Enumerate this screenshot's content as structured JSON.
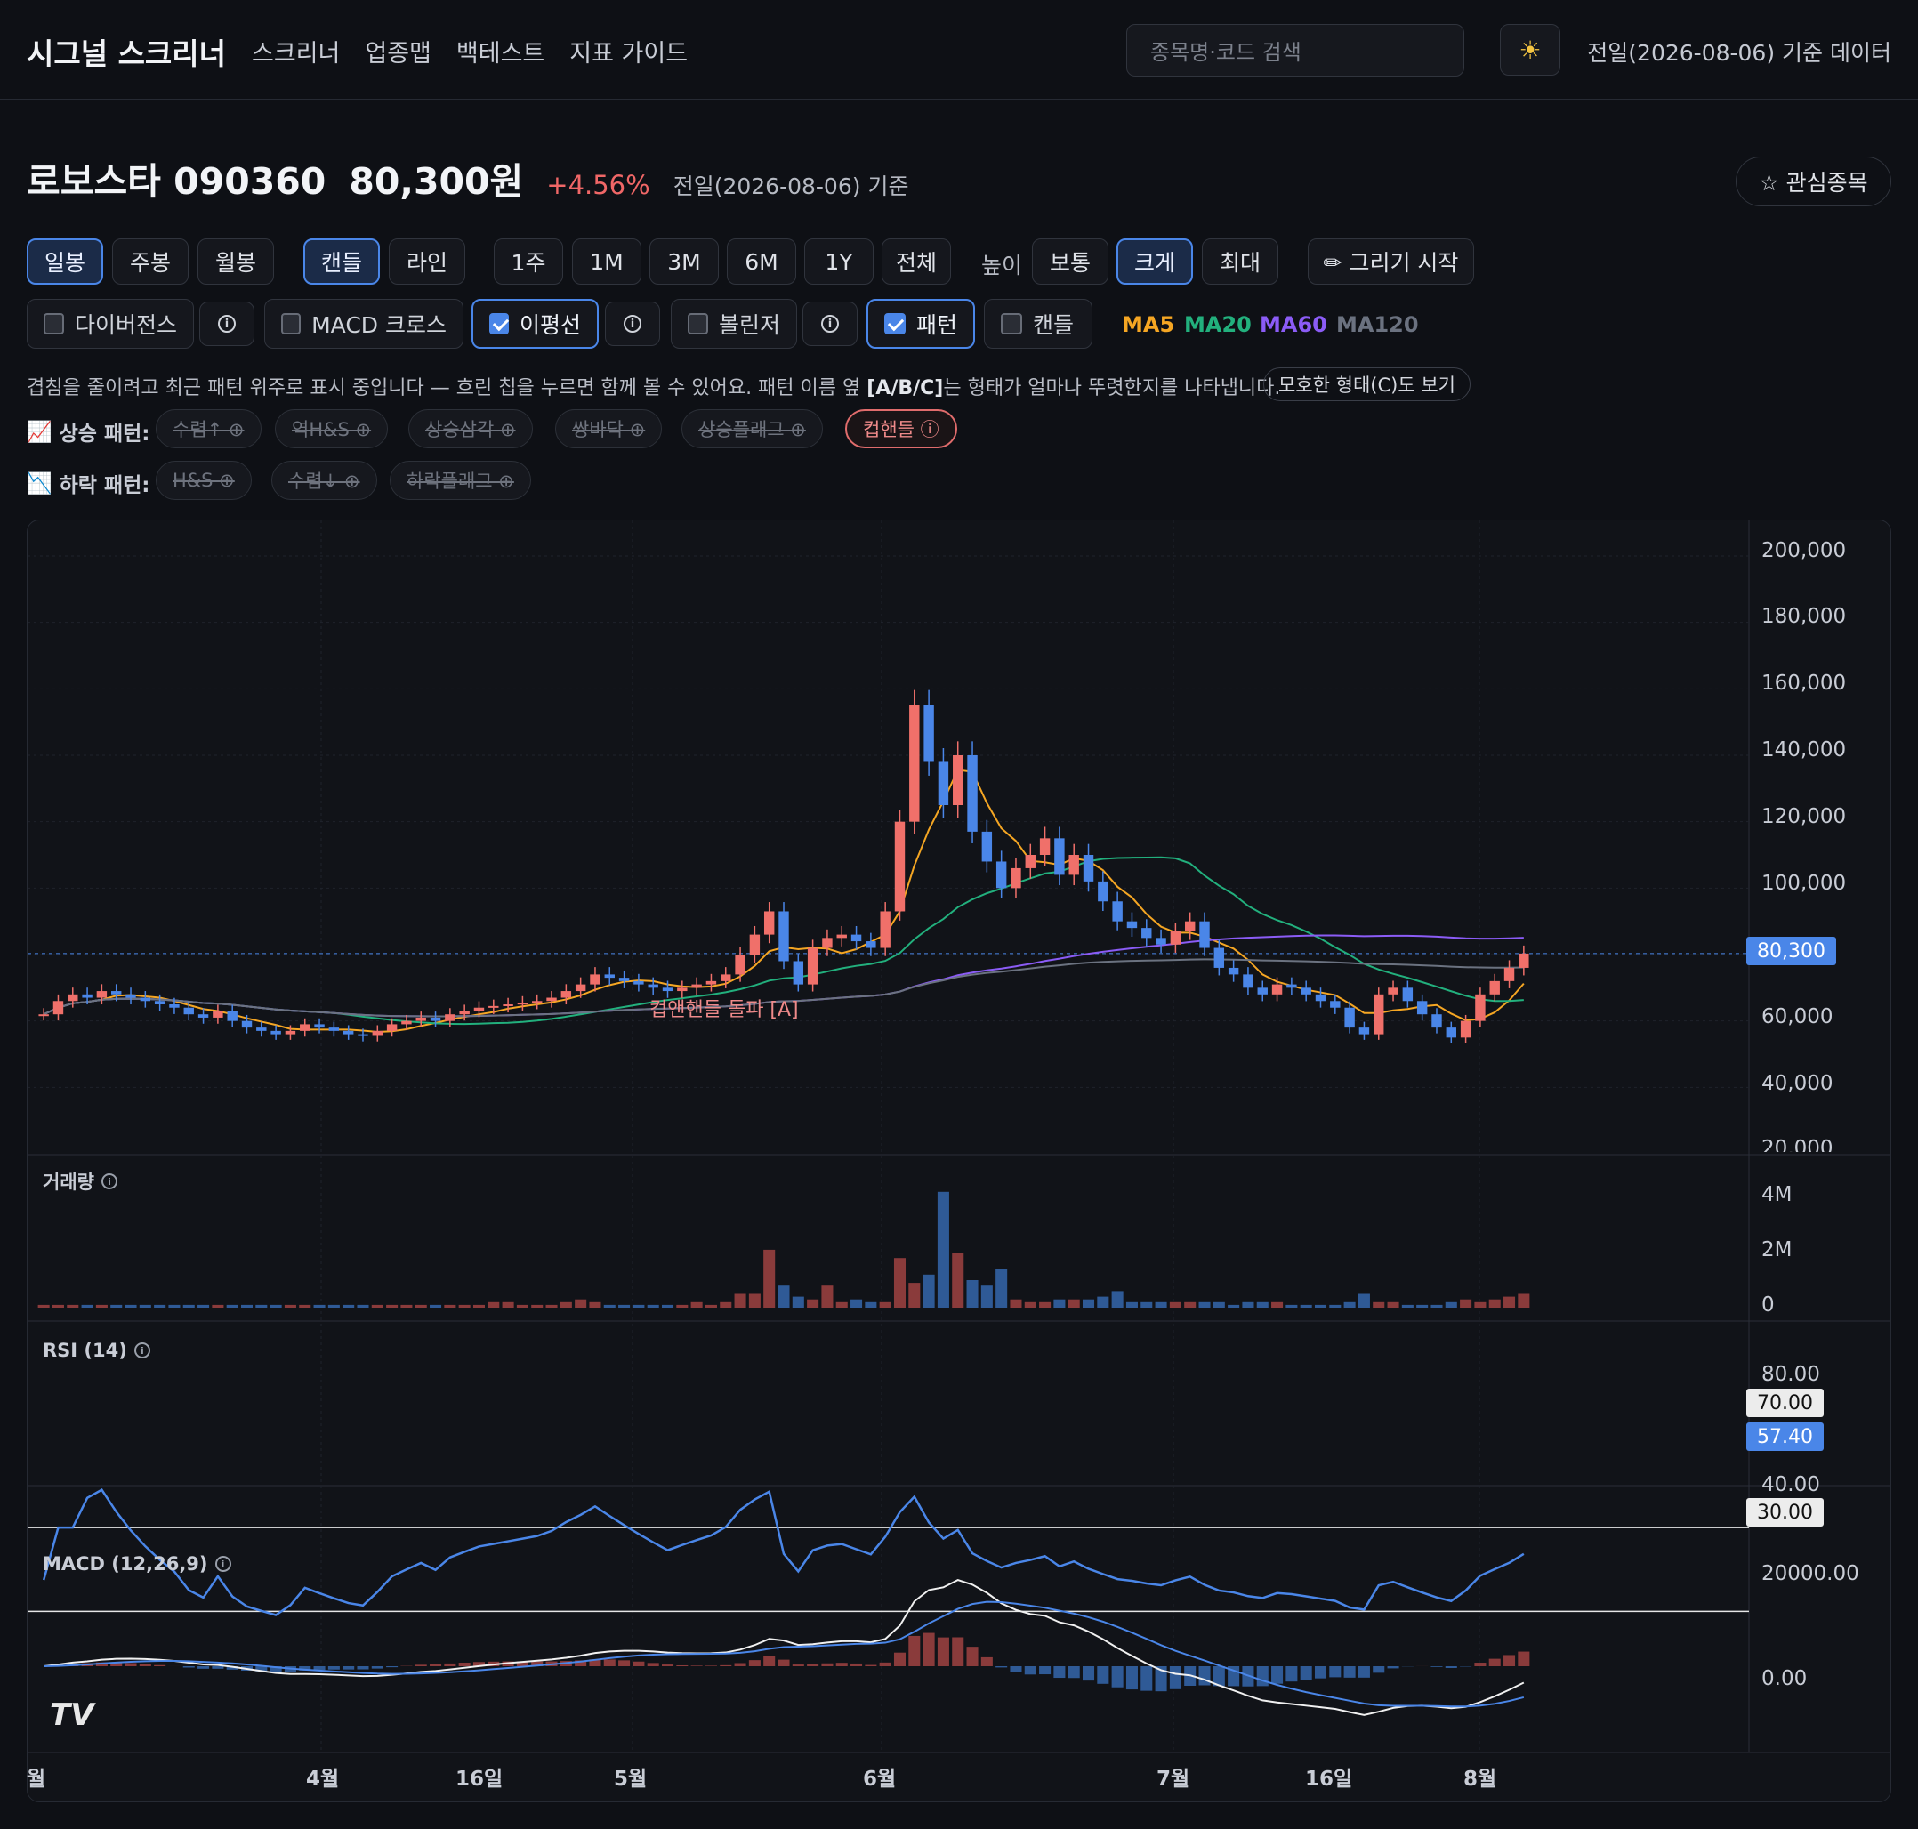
{
  "nav": {
    "brand": "시그널 스크리너",
    "links": [
      "스크리너",
      "업종맵",
      "백테스트",
      "지표 가이드"
    ],
    "search_placeholder": "종목명·코드 검색",
    "theme_icon": "sun-icon",
    "data_date": "전일(2026-08-06) 기준 데이터"
  },
  "stock": {
    "name": "로보스타 090360",
    "price": "80,300원",
    "change": "+4.56%",
    "basis": "전일(2026-08-06) 기준",
    "fav_label": "☆ 관심종목"
  },
  "controls": {
    "period": [
      "일봉",
      "주봉",
      "월봉"
    ],
    "style": [
      "캔들",
      "라인"
    ],
    "ranges": [
      "1주",
      "1M",
      "3M",
      "6M",
      "1Y",
      "전체"
    ],
    "height_label": "높이",
    "heights": [
      "보통",
      "크게",
      "최대"
    ],
    "draw": "✏ 그리기 시작"
  },
  "indicators": {
    "divergence": "다이버전스",
    "macd_cross": "MACD 크로스",
    "ma_lines": "이평선",
    "bollinger": "볼린저",
    "pattern": "패턴",
    "candle": "캔들",
    "ma_legend": [
      {
        "label": "MA5",
        "color": "#f5a623"
      },
      {
        "label": "MA20",
        "color": "#22b07d"
      },
      {
        "label": "MA60",
        "color": "#8b5cf6"
      },
      {
        "label": "MA120",
        "color": "#6b7280"
      }
    ]
  },
  "patterns": {
    "notice_1": "겹침을 줄이려고 최근 패턴 위주로 표시 중입니다 — 흐린 칩을 누르면 함께 볼 수 있어요. 패턴 이름 옆 ",
    "notice_b": "[A/B/C]",
    "notice_2": "는 형태가 얼마나 뚜렷한지를 나타냅니다.",
    "ambiguous_btn": "모호한 형태(C)도 보기",
    "up_label": "상승 패턴:",
    "up_chips": [
      "수렴↑ ⊕",
      "역H&S ⊕",
      "상승삼각 ⊕",
      "쌍바닥 ⊕",
      "상승플래그 ⊕",
      "컵핸들 ⓘ"
    ],
    "down_label": "하락 패턴:",
    "down_chips": [
      "H&S ⊕",
      "수렴↓ ⊕",
      "하락플래그 ⊕"
    ],
    "chart_annotation": "컵앤핸들 돌파 [A]"
  },
  "chart": {
    "price_axis": [
      "200,000",
      "180,000",
      "160,000",
      "140,000",
      "120,000",
      "100,000",
      "60,000",
      "40,000",
      "20,000"
    ],
    "last_price_tag": "80,300",
    "volume_label": "거래량",
    "volume_axis": [
      "4M",
      "2M",
      "0"
    ],
    "rsi_label": "RSI (14)",
    "rsi_axis": [
      "80.00",
      "40.00"
    ],
    "rsi_70": "70.00",
    "rsi_30": "30.00",
    "rsi_value": "57.40",
    "macd_label": "MACD (12,26,9)",
    "macd_axis": [
      "20000.00",
      "0.00"
    ],
    "x_axis": [
      "월",
      "4월",
      "16일",
      "5월",
      "6월",
      "7월",
      "16일",
      "8월"
    ],
    "watermark": "TV"
  },
  "chart_data": {
    "type": "candlestick",
    "ylim": [
      20000,
      200000
    ],
    "last_close": 80300,
    "rsi_last": 57.4,
    "closes": [
      62000,
      66000,
      68000,
      67000,
      69000,
      68000,
      67000,
      66000,
      65000,
      64000,
      62000,
      61000,
      63000,
      60000,
      58000,
      57000,
      56000,
      57000,
      59000,
      58000,
      57000,
      56000,
      55500,
      57000,
      59000,
      60000,
      61000,
      60000,
      62000,
      63000,
      64000,
      64500,
      65000,
      65500,
      66000,
      67000,
      69000,
      71000,
      74000,
      73000,
      72000,
      71000,
      70000,
      69000,
      70000,
      71000,
      72000,
      74000,
      80000,
      86000,
      93000,
      78000,
      71000,
      82000,
      85000,
      86000,
      84000,
      82000,
      93000,
      120000,
      155000,
      138000,
      125000,
      140000,
      117000,
      108000,
      100000,
      106000,
      110000,
      115000,
      104000,
      110000,
      102000,
      96000,
      90000,
      88000,
      85000,
      83000,
      87000,
      90000,
      82000,
      76000,
      74000,
      70000,
      68000,
      71000,
      70000,
      68000,
      66000,
      64000,
      58000,
      56000,
      68000,
      70000,
      66000,
      62000,
      58000,
      55000,
      60000,
      68000,
      72000,
      76000,
      80300
    ],
    "volume_m": [
      0.1,
      0.1,
      0.1,
      0.1,
      0.1,
      0.1,
      0.1,
      0.1,
      0.1,
      0.1,
      0.1,
      0.1,
      0.1,
      0.1,
      0.1,
      0.1,
      0.1,
      0.1,
      0.1,
      0.1,
      0.1,
      0.1,
      0.1,
      0.1,
      0.1,
      0.1,
      0.1,
      0.1,
      0.1,
      0.1,
      0.1,
      0.2,
      0.2,
      0.1,
      0.1,
      0.1,
      0.2,
      0.3,
      0.2,
      0.1,
      0.1,
      0.1,
      0.1,
      0.1,
      0.1,
      0.2,
      0.1,
      0.2,
      0.5,
      0.5,
      2.1,
      0.8,
      0.4,
      0.3,
      0.8,
      0.2,
      0.3,
      0.2,
      0.2,
      1.8,
      0.9,
      1.2,
      4.2,
      2.0,
      1.0,
      0.8,
      1.4,
      0.3,
      0.2,
      0.2,
      0.3,
      0.3,
      0.3,
      0.4,
      0.6,
      0.2,
      0.2,
      0.2,
      0.2,
      0.2,
      0.2,
      0.2,
      0.1,
      0.2,
      0.2,
      0.2,
      0.1,
      0.1,
      0.1,
      0.1,
      0.2,
      0.5,
      0.2,
      0.2,
      0.1,
      0.1,
      0.1,
      0.2,
      0.3,
      0.2,
      0.3,
      0.4,
      0.5
    ]
  }
}
